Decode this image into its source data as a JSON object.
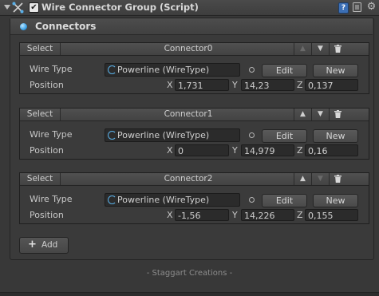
{
  "header": {
    "enabled_mark": "✔",
    "title": "Wire Connector Group (Script)",
    "help_label": "?",
    "gear_label": "⚙"
  },
  "section": {
    "title": "Connectors"
  },
  "connectors": [
    {
      "select_label": "Select",
      "name": "Connector0",
      "up_label": "▲",
      "down_label": "▼",
      "up_enabled": false,
      "down_enabled": true,
      "wire_type_label": "Wire Type",
      "wire_type_value": "Powerline (WireType)",
      "edit_label": "Edit",
      "new_label": "New",
      "position_label": "Position",
      "x_label": "X",
      "x_value": "1,731",
      "y_label": "Y",
      "y_value": "14,23",
      "z_label": "Z",
      "z_value": "0,137"
    },
    {
      "select_label": "Select",
      "name": "Connector1",
      "up_label": "▲",
      "down_label": "▼",
      "up_enabled": true,
      "down_enabled": true,
      "wire_type_label": "Wire Type",
      "wire_type_value": "Powerline (WireType)",
      "edit_label": "Edit",
      "new_label": "New",
      "position_label": "Position",
      "x_label": "X",
      "x_value": "0",
      "y_label": "Y",
      "y_value": "14,979",
      "z_label": "Z",
      "z_value": "0,16"
    },
    {
      "select_label": "Select",
      "name": "Connector2",
      "up_label": "▲",
      "down_label": "▼",
      "up_enabled": true,
      "down_enabled": false,
      "wire_type_label": "Wire Type",
      "wire_type_value": "Powerline (WireType)",
      "edit_label": "Edit",
      "new_label": "New",
      "position_label": "Position",
      "x_label": "X",
      "x_value": "-1,56",
      "y_label": "Y",
      "y_value": "14,226",
      "z_label": "Z",
      "z_value": "0,155"
    }
  ],
  "add": {
    "plus": "+",
    "label": "Add"
  },
  "footer": {
    "text": "- Staggart Creations -"
  },
  "colors": {
    "accent": "#3aa0e6",
    "panel": "#3a3a3a",
    "field": "#2b2b2b"
  }
}
